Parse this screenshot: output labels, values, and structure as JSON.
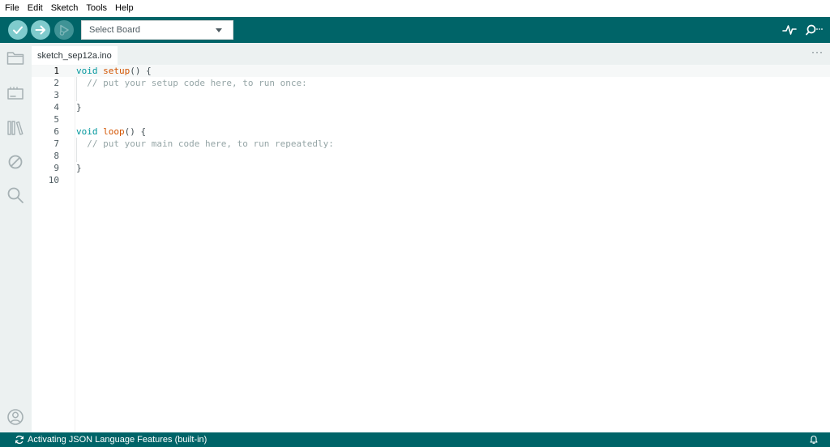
{
  "menu": [
    "File",
    "Edit",
    "Sketch",
    "Tools",
    "Help"
  ],
  "toolbar": {
    "verify_icon": "check-icon",
    "upload_icon": "arrow-right-icon",
    "debug_icon": "debug-play-icon",
    "board_select": "Select Board",
    "serial_plotter_icon": "pulse-icon",
    "serial_monitor_icon": "magnifier-dots-icon"
  },
  "sidebar": {
    "items": [
      "folder-icon",
      "board-icon",
      "library-icon",
      "no-entry-icon",
      "search-icon"
    ],
    "bottom": "user-icon"
  },
  "tab": {
    "name": "sketch_sep12a.ino",
    "more": "···"
  },
  "code": {
    "line_numbers": [
      "1",
      "2",
      "3",
      "4",
      "5",
      "6",
      "7",
      "8",
      "9",
      "10"
    ],
    "current_line": 1,
    "setup_keyword": "void",
    "setup_fn": "setup",
    "setup_open": "() {",
    "setup_comment": "  // put your setup code here, to run once:",
    "setup_close": "}",
    "loop_keyword": "void",
    "loop_fn": "loop",
    "loop_open": "() {",
    "loop_comment": "  // put your main code here, to run repeatedly:",
    "loop_close": "}"
  },
  "status": {
    "icon": "sync-icon",
    "text": "Activating JSON Language Features (built-in)",
    "bell_icon": "bell-icon"
  },
  "colors": {
    "teal": "#006468",
    "button": "#7fcbcd",
    "sidebar": "#ecf1f1",
    "keyword": "#00979d",
    "function": "#d35400",
    "comment": "#95a5a6"
  }
}
